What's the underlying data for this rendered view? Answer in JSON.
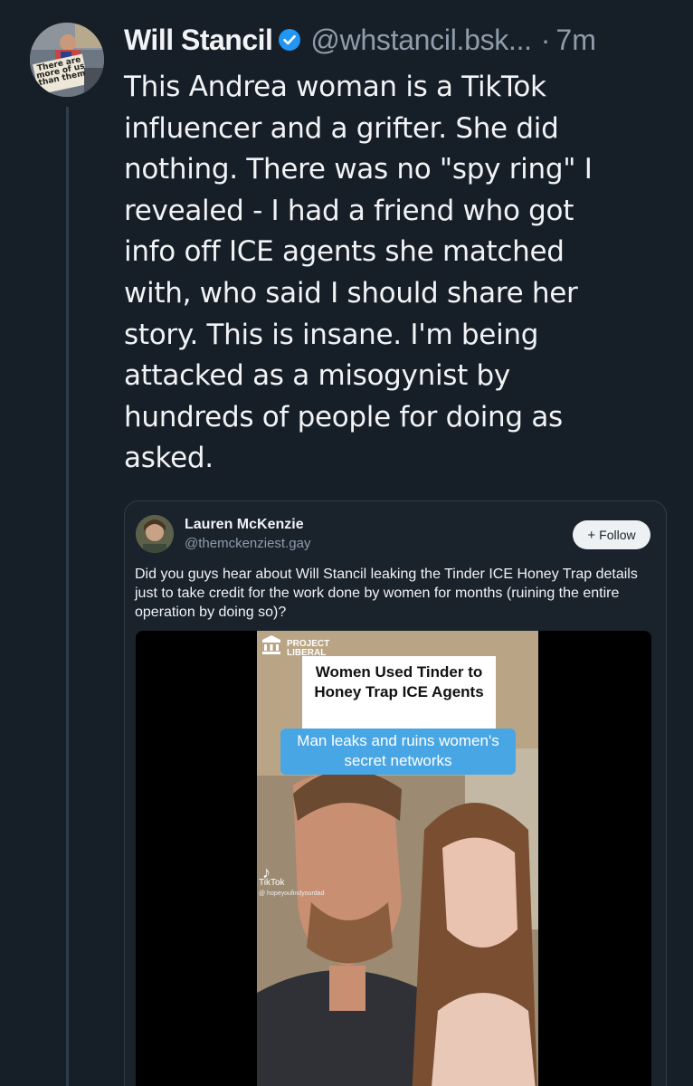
{
  "post": {
    "display_name": "Will Stancil",
    "handle": "@whstancil.bsk...",
    "separator": "·",
    "time": "7m",
    "avatar_sign_text": "There are more of us than them",
    "text": "This Andrea woman is a TikTok\ninfluencer and a grifter. She did\nnothing. There was no \"spy ring\" I\nrevealed - I had a friend who got\ninfo off ICE agents she matched\nwith, who said I should share her\nstory. This is insane. I'm being\nattacked as a misogynist by\nhundreds of people for doing as\nasked."
  },
  "quote": {
    "display_name": "Lauren McKenzie",
    "handle": "@themckenziest.gay",
    "follow_plus": "+",
    "follow_label": "Follow",
    "text": "Did you guys hear about Will Stancil leaking the Tinder ICE Honey Trap details just to take credit for the work done by women for months (ruining the entire operation by doing so)?",
    "video": {
      "logo_line1": "PROJECT",
      "logo_line2": "LIBERAL",
      "headline": "Women Used Tinder to Honey Trap ICE Agents",
      "subhead": "Man leaks and ruins women's secret networks",
      "tiktok_label": "TikTok",
      "tiktok_user": "@ hopeyoufindyourdad"
    }
  },
  "colors": {
    "background": "#161e27",
    "text": "#f1f3f5",
    "muted": "#8f9cab",
    "verified": "#2196f3",
    "subhead_bg": "#49a6e4"
  },
  "icons": {
    "verified": "verified-checkmark-icon",
    "tiktok": "tiktok-icon"
  }
}
